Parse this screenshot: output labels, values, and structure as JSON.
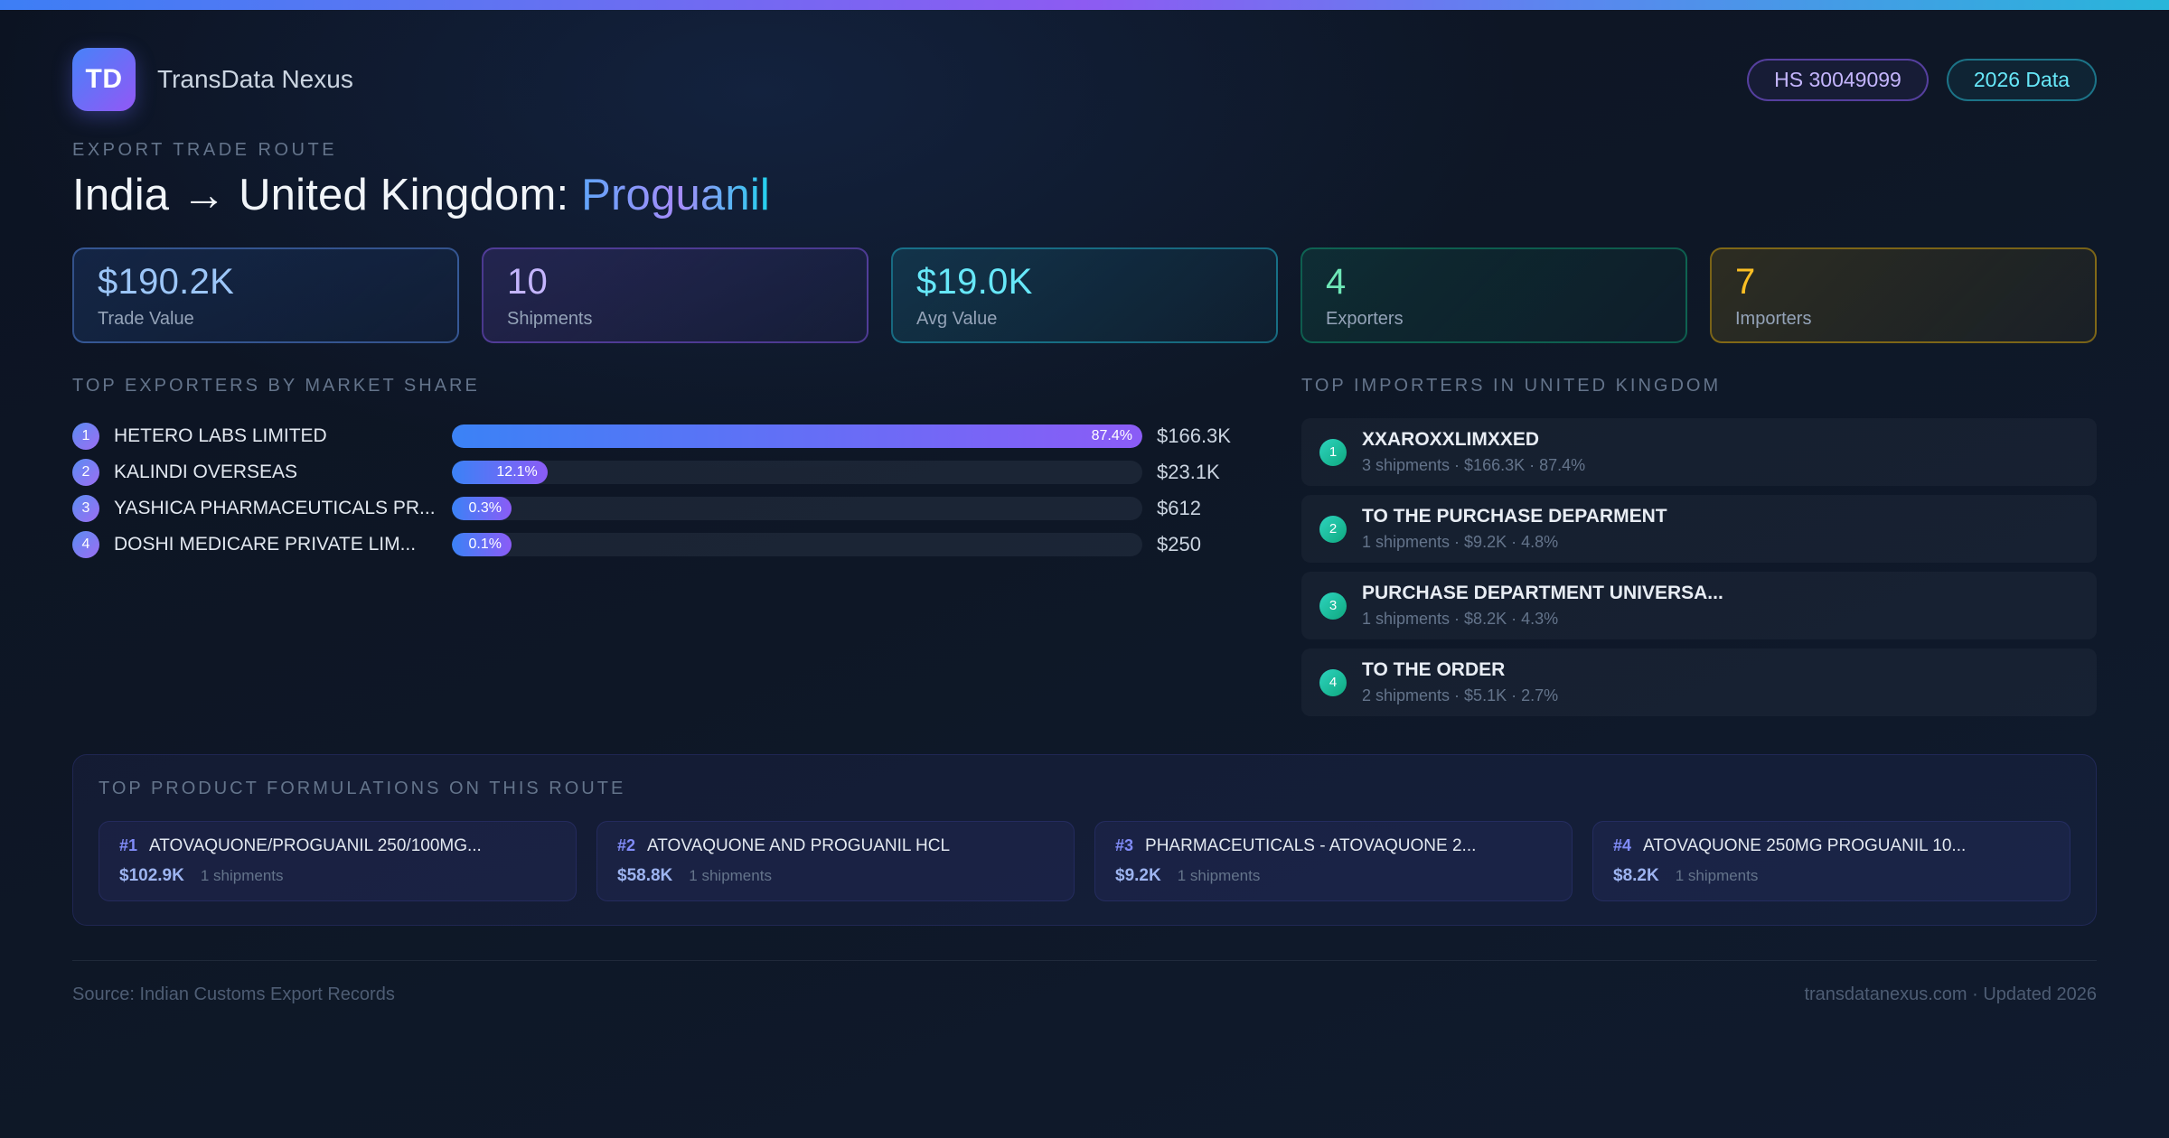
{
  "header": {
    "logo_text": "TD",
    "app_name": "TransData Nexus",
    "hs_badge": "HS 30049099",
    "year_badge": "2026 Data"
  },
  "hero": {
    "eyebrow": "EXPORT TRADE ROUTE",
    "title_prefix": "India → United Kingdom: ",
    "title_highlight": "Proguanil"
  },
  "stats": [
    {
      "value": "$190.2K",
      "label": "Trade Value"
    },
    {
      "value": "10",
      "label": "Shipments"
    },
    {
      "value": "$19.0K",
      "label": "Avg Value"
    },
    {
      "value": "4",
      "label": "Exporters"
    },
    {
      "value": "7",
      "label": "Importers"
    }
  ],
  "exporters": {
    "heading": "TOP EXPORTERS BY MARKET SHARE",
    "rows": [
      {
        "rank": "1",
        "name": "HETERO LABS LIMITED",
        "share_pct": 87.4,
        "share_label": "87.4%",
        "value": "$166.3K"
      },
      {
        "rank": "2",
        "name": "KALINDI OVERSEAS",
        "share_pct": 12.1,
        "share_label": "12.1%",
        "value": "$23.1K"
      },
      {
        "rank": "3",
        "name": "YASHICA PHARMACEUTICALS PR...",
        "share_pct": 0.3,
        "share_label": "0.3%",
        "value": "$612"
      },
      {
        "rank": "4",
        "name": "DOSHI MEDICARE PRIVATE LIM...",
        "share_pct": 0.1,
        "share_label": "0.1%",
        "value": "$250"
      }
    ]
  },
  "importers": {
    "heading": "TOP IMPORTERS IN UNITED KINGDOM",
    "rows": [
      {
        "rank": "1",
        "name": "XXAROXXLIMXXED",
        "meta": "3 shipments · $166.3K · 87.4%"
      },
      {
        "rank": "2",
        "name": "TO THE PURCHASE DEPARMENT",
        "meta": "1 shipments · $9.2K · 4.8%"
      },
      {
        "rank": "3",
        "name": "PURCHASE DEPARTMENT UNIVERSA...",
        "meta": "1 shipments · $8.2K · 4.3%"
      },
      {
        "rank": "4",
        "name": "TO THE ORDER",
        "meta": "2 shipments · $5.1K · 2.7%"
      }
    ]
  },
  "products": {
    "heading": "TOP PRODUCT FORMULATIONS ON THIS ROUTE",
    "cards": [
      {
        "rank": "#1",
        "name": "ATOVAQUONE/PROGUANIL 250/100MG...",
        "value": "$102.9K",
        "shipments": "1 shipments"
      },
      {
        "rank": "#2",
        "name": "ATOVAQUONE AND PROGUANIL HCL",
        "value": "$58.8K",
        "shipments": "1 shipments"
      },
      {
        "rank": "#3",
        "name": "PHARMACEUTICALS - ATOVAQUONE 2...",
        "value": "$9.2K",
        "shipments": "1 shipments"
      },
      {
        "rank": "#4",
        "name": "ATOVAQUONE 250MG PROGUANIL 10...",
        "value": "$8.2K",
        "shipments": "1 shipments"
      }
    ]
  },
  "footer": {
    "source": "Source: Indian Customs Export Records",
    "site": "transdatanexus.com · Updated 2026"
  },
  "colors": {
    "accent_blue": "#3b82f6",
    "accent_purple": "#8b5cf6",
    "accent_cyan": "#22d3ee",
    "accent_green": "#10b981",
    "accent_amber": "#fbbf24",
    "background": "#0e1726"
  }
}
